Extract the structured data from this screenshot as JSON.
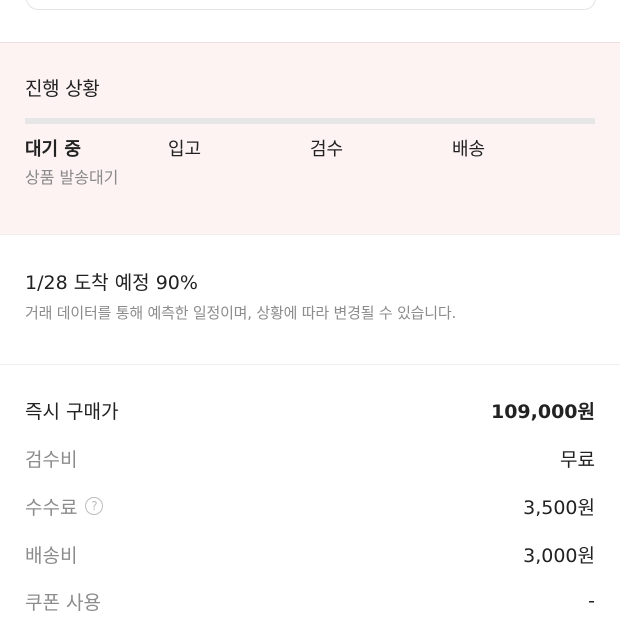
{
  "progress": {
    "title": "진행 상황",
    "steps": [
      {
        "label": "대기 중"
      },
      {
        "label": "입고"
      },
      {
        "label": "검수"
      },
      {
        "label": "배송"
      }
    ],
    "active_step_sub": "상품 발송대기"
  },
  "estimate": {
    "title": "1/28 도착 예정 90%",
    "description": "거래 데이터를 통해 예측한 일정이며, 상황에 따라 변경될 수 있습니다."
  },
  "price": {
    "rows": [
      {
        "label": "즉시 구매가",
        "value": "109,000원"
      },
      {
        "label": "검수비",
        "value": "무료"
      },
      {
        "label": "수수료",
        "value": "3,500원",
        "help_icon": "?"
      },
      {
        "label": "배송비",
        "value": "3,000원"
      },
      {
        "label": "쿠폰 사용",
        "value": "-"
      }
    ]
  }
}
